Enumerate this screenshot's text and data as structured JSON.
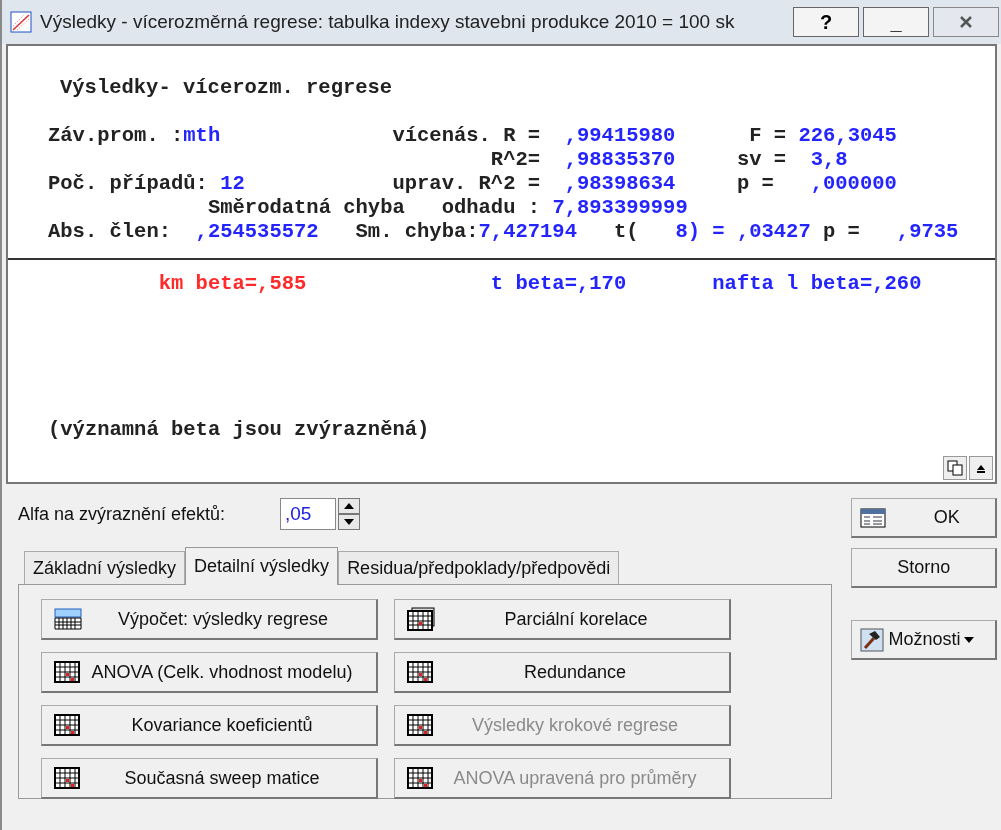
{
  "window": {
    "title": "Výsledky - vícerozměrná regrese: tabulka indexy stavebni produkce 2010 = 100 sk",
    "controls": [
      "?",
      "_"
    ]
  },
  "output": {
    "heading": "Výsledky- vícerozm. regrese",
    "lines": [
      [
        {
          "text": "Záv.prom. :",
          "kind": "label"
        },
        {
          "text": "mth",
          "kind": "value"
        },
        {
          "text": "vícenás. R =",
          "kind": "label"
        },
        {
          "text": ",99415980",
          "kind": "value"
        },
        {
          "text": "F =",
          "kind": "label"
        },
        {
          "text": "226,3045",
          "kind": "value"
        }
      ],
      [
        {
          "text": "R^2=",
          "kind": "label"
        },
        {
          "text": ",98835370",
          "kind": "value"
        },
        {
          "text": "sv =",
          "kind": "label"
        },
        {
          "text": "3,8",
          "kind": "value"
        }
      ],
      [
        {
          "text": "Poč. případů:",
          "kind": "label"
        },
        {
          "text": "12",
          "kind": "value"
        },
        {
          "text": "uprav. R^2 =",
          "kind": "label"
        },
        {
          "text": ",98398634",
          "kind": "value"
        },
        {
          "text": "p =",
          "kind": "label"
        },
        {
          "text": ",000000",
          "kind": "value"
        }
      ],
      [
        {
          "text": "Směrodatná chyba   odhadu :",
          "kind": "label"
        },
        {
          "text": "7,893399999",
          "kind": "value"
        }
      ],
      [
        {
          "text": "Abs. člen:",
          "kind": "label"
        },
        {
          "text": ",254535572",
          "kind": "value"
        },
        {
          "text": "Sm. chyba:",
          "kind": "label"
        },
        {
          "text": "7,427194",
          "kind": "value"
        },
        {
          "text": "t(",
          "kind": "label"
        },
        {
          "text": "8) =",
          "kind": "value"
        },
        {
          "text": ",03427",
          "kind": "value"
        },
        {
          "text": "p =",
          "kind": "label"
        },
        {
          "text": ",9735",
          "kind": "value"
        }
      ]
    ],
    "betas": [
      {
        "text": "km beta=,585",
        "significant": true
      },
      {
        "text": "t beta=,170",
        "significant": false
      },
      {
        "text": "nafta l beta=,260",
        "significant": false
      }
    ],
    "note": "(významná beta jsou zvýrazněná)"
  },
  "alpha": {
    "label": "Alfa na zvýraznění efektů:",
    "value": ",05"
  },
  "tabs": [
    {
      "label": "Základní výsledky",
      "selected": false
    },
    {
      "label": "Detailní výsledky",
      "selected": true
    },
    {
      "label": "Residua/předpoklady/předpovědi",
      "selected": false
    }
  ],
  "buttons": [
    {
      "label": "Výpočet: výsledky regrese",
      "kind": "summary",
      "disabled": false
    },
    {
      "label": "Parciální korelace",
      "kind": "stack",
      "disabled": false
    },
    {
      "label": "ANOVA (Celk. vhodnost modelu)",
      "kind": "table",
      "disabled": false
    },
    {
      "label": "Redundance",
      "kind": "table",
      "disabled": false
    },
    {
      "label": "Kovariance koeficientů",
      "kind": "table",
      "disabled": false
    },
    {
      "label": "Výsledky krokové regrese",
      "kind": "table",
      "disabled": true
    },
    {
      "label": "Současná sweep matice",
      "kind": "table",
      "disabled": false
    },
    {
      "label": "ANOVA upravená pro průměry",
      "kind": "table",
      "disabled": true
    }
  ],
  "side_buttons": [
    {
      "label": "OK",
      "kind": "ok"
    },
    {
      "label": "Storno",
      "kind": "plain"
    },
    {
      "label": "Možnosti",
      "kind": "menu"
    }
  ]
}
